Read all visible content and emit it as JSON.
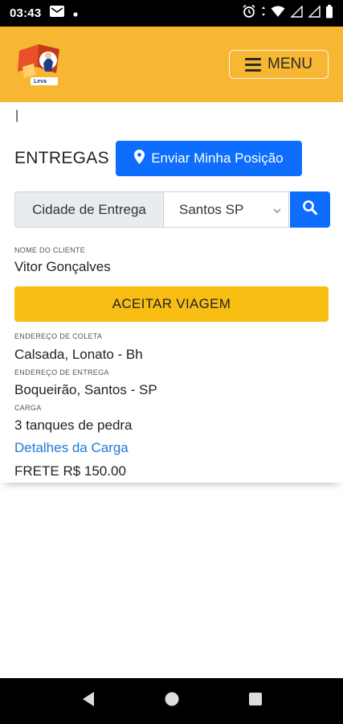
{
  "status_bar": {
    "time": "03:43",
    "icons": [
      "gmail-icon",
      "dot-icon",
      "alarm-icon",
      "wifi-icon",
      "signal-icon",
      "signal-icon",
      "battery-icon"
    ]
  },
  "header": {
    "logo_text": "Leva",
    "menu_label": "MENU"
  },
  "entregas": {
    "cursor_text": "|",
    "title": "ENTREGAS",
    "send_position_label": "Enviar Minha Posição",
    "city_label": "Cidade de Entrega",
    "city_selected": "Santos SP"
  },
  "delivery": {
    "client_name_label": "NOME DO CLIENTE",
    "client_name": "Vitor Gonçalves",
    "accept_label": "ACEITAR VIAGEM",
    "pickup_label": "ENDEREÇO DE COLETA",
    "pickup_address": "Calsada, Lonato - Bh",
    "delivery_label": "ENDEREÇO DE ENTREGA",
    "delivery_address": "Boqueirão, Santos - SP",
    "cargo_label": "CARGA",
    "cargo": "3 tanques de pedra",
    "cargo_details_link": "Detalhes da Carga",
    "freight": "FRETE R$ 150.00"
  },
  "colors": {
    "header": "#f7b733",
    "primary": "#0d6efd",
    "warning": "#f8be14",
    "link": "#1e7ad6"
  }
}
